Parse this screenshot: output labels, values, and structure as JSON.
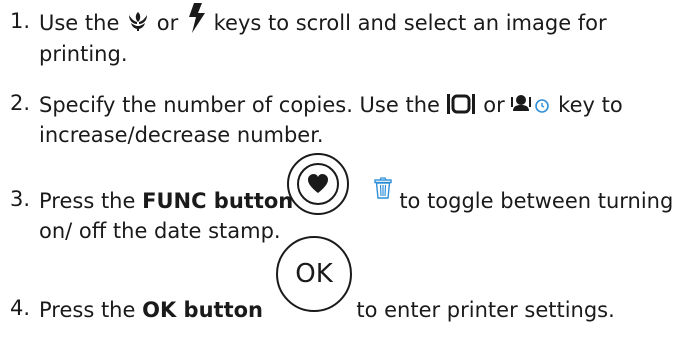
{
  "steps": [
    {
      "number": "1.",
      "text_a": "Use the",
      "text_b": "or",
      "text_c": "keys to scroll and select an image for printing.",
      "icons": [
        "macro-flower-icon",
        "flash-bolt-icon"
      ]
    },
    {
      "number": "2.",
      "text_a": "Specify the number of copies. Use the",
      "text_b": "or",
      "text_c": "key to increase/decrease number.",
      "icons": [
        "display-toggle-icon",
        "self-timer-portrait-icon"
      ]
    },
    {
      "number": "3.",
      "text_a": "Press the",
      "bold": "FUNC button",
      "text_c": "to toggle between turning on/ off the date stamp.",
      "icons": [
        "heart-func-button-icon",
        "trash-icon"
      ]
    },
    {
      "number": "4.",
      "text_a": "Press the",
      "bold": "OK button",
      "text_c": "to enter printer settings.",
      "button_label": "OK"
    }
  ],
  "colors": {
    "text": "#1a1a1a",
    "accent_blue": "#2f8fd8"
  }
}
